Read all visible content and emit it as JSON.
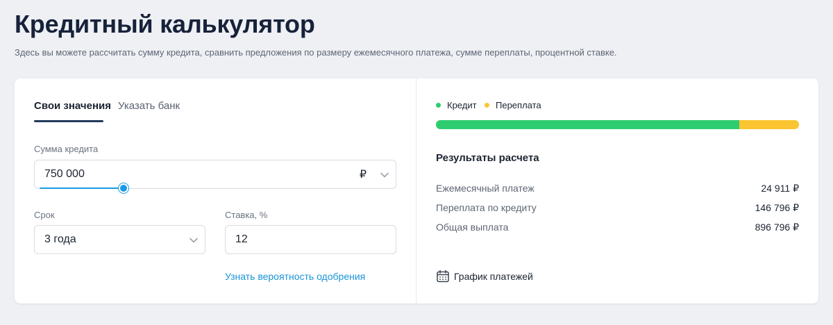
{
  "header": {
    "title": "Кредитный калькулятор",
    "subtitle": "Здесь вы можете рассчитать сумму кредита, сравнить предложения по размеру ежемесячного платежа, сумме переплаты, процентной ставке."
  },
  "tabs": [
    {
      "label": "Свои значения",
      "active": true
    },
    {
      "label": "Указать банк",
      "active": false
    }
  ],
  "form": {
    "amount": {
      "label": "Сумма кредита",
      "value": "750 000",
      "currency": "₽",
      "slider_level": 0.24
    },
    "term": {
      "label": "Срок",
      "value": "3 года"
    },
    "rate": {
      "label": "Ставка, %",
      "value": "12"
    },
    "approval_link": "Узнать вероятность одобрения"
  },
  "legend": [
    {
      "label": "Кредит",
      "color": "#2ecc71"
    },
    {
      "label": "Переплата",
      "color": "#fbc531"
    }
  ],
  "breakdown": {
    "credit_share": 0.836,
    "overpay_share": 0.164
  },
  "results": {
    "title": "Результаты расчета",
    "rows": [
      {
        "label": "Ежемесячный платеж",
        "value": "24 911 ₽"
      },
      {
        "label": "Переплата по кредиту",
        "value": "146 796 ₽"
      },
      {
        "label": "Общая выплата",
        "value": "896 796 ₽"
      }
    ]
  },
  "schedule": {
    "label": "График платежей",
    "icon": "calendar-icon"
  },
  "colors": {
    "accent": "#1a93d8",
    "tab_underline": "#23395b"
  }
}
